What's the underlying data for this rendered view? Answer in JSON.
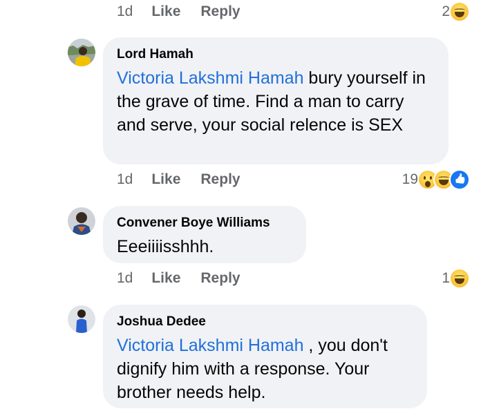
{
  "top_actions": {
    "time": "1d",
    "like": "Like",
    "reply": "Reply",
    "count": "2"
  },
  "comments": [
    {
      "author": "Lord Hamah",
      "mention": "Victoria Lakshmi Hamah",
      "text": " bury yourself in the grave of time.  Find a man to carry and serve, your social relence is SEX",
      "time": "1d",
      "like": "Like",
      "reply": "Reply",
      "reaction_count": "19",
      "reactions": [
        "wow-icon",
        "haha-icon",
        "like-icon"
      ]
    },
    {
      "author": "Convener Boye Williams",
      "mention": "",
      "text": "Eeeiiiisshhh.",
      "time": "1d",
      "like": "Like",
      "reply": "Reply",
      "reaction_count": "1",
      "reactions": [
        "haha-icon"
      ]
    },
    {
      "author": "Joshua Dedee",
      "mention": "Victoria Lakshmi Hamah",
      "text": " , you don't dignify him with a response. Your brother needs help.",
      "time": "",
      "like": "",
      "reply": "",
      "reaction_count": "",
      "reactions": []
    }
  ],
  "colors": {
    "bubble": "#f0f2f5",
    "mention": "#216fdb",
    "meta": "#65676b",
    "like_blue": "#1877f2"
  }
}
